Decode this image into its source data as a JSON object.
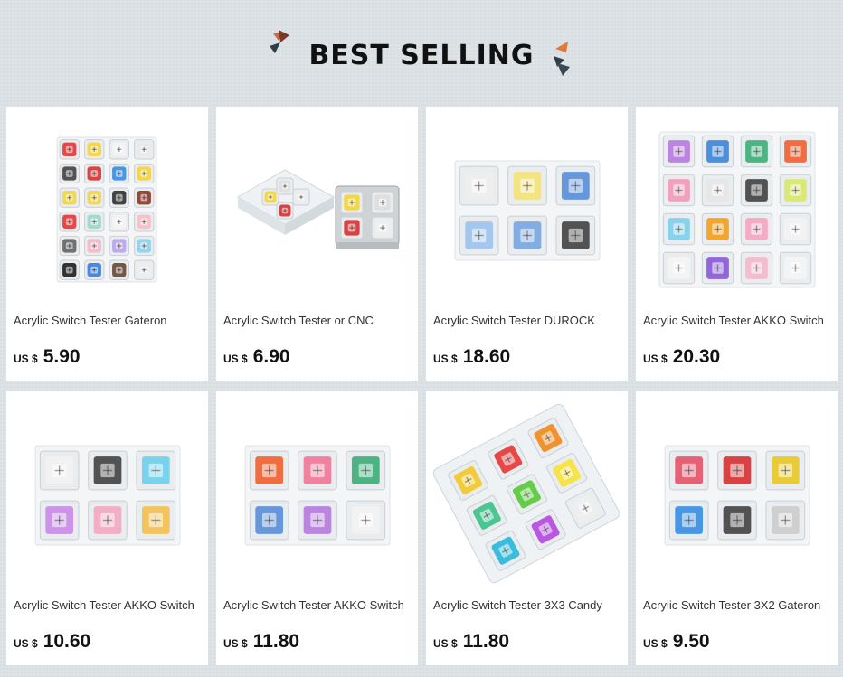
{
  "header": {
    "title": "BEST SELLING"
  },
  "currency_label": "US $",
  "products": [
    {
      "title": "Acrylic Switch Tester Gateron",
      "price": "5.90",
      "image": "acrylic-tester-24-switches",
      "grid": [
        4,
        6
      ],
      "colors": [
        "#e53a3a",
        "#f3d43b",
        "#f3f3f3",
        "#e9e9e9",
        "#444444",
        "#d73333",
        "#3a8fe3",
        "#f3d43b",
        "#f1d646",
        "#f1d646",
        "#333333",
        "#8b3a2a",
        "#e53a3a",
        "#9bd9c8",
        "#f3f3f3",
        "#f5c0c8",
        "#666666",
        "#f5b8c8",
        "#b8a5e8",
        "#8fd1ea",
        "#222222",
        "#3a7fe0",
        "#6a4a3a",
        "#eeeeee"
      ]
    },
    {
      "title": "Acrylic Switch Tester or CNC",
      "price": "6.90",
      "image": "acrylic-and-cnc-testers",
      "grid": [
        0,
        0
      ],
      "colors": []
    },
    {
      "title": "Acrylic Switch Tester DUROCK",
      "price": "18.60",
      "image": "durock-tester-6-switches",
      "grid": [
        3,
        2
      ],
      "colors": [
        "#eeeeee",
        "#f3e27a",
        "#5a8fd8",
        "#9ec3ee",
        "#7aa6df",
        "#444444"
      ]
    },
    {
      "title": "Acrylic Switch Tester AKKO Switch",
      "price": "20.30",
      "image": "akko-tester-16-switches",
      "grid": [
        4,
        4
      ],
      "colors": [
        "#b77be0",
        "#3e87d8",
        "#3fb07a",
        "#f06230",
        "#f29ab8",
        "#e6e6e6",
        "#444444",
        "#d8e86a",
        "#7fd0ea",
        "#f2a020",
        "#f4a5c0",
        "#f2f2f2",
        "#f4f4f4",
        "#8a5ad8",
        "#f2b9cc",
        "#f4f4f4"
      ]
    },
    {
      "title": "Acrylic Switch Tester AKKO Switch",
      "price": "10.60",
      "image": "akko-tester-6-switches",
      "grid": [
        3,
        2
      ],
      "colors": [
        "#f2f2f2",
        "#444444",
        "#6fd0ea",
        "#c98be8",
        "#f2a8c0",
        "#f2c050"
      ]
    },
    {
      "title": "Acrylic Switch Tester AKKO Switch",
      "price": "11.80",
      "image": "akko-tester-6-switches-b",
      "grid": [
        3,
        2
      ],
      "colors": [
        "#f06230",
        "#f07898",
        "#3fae7a",
        "#5a8fd8",
        "#b77be0",
        "#f2f2f2"
      ]
    },
    {
      "title": "Acrylic Switch Tester 3X3 Candy",
      "price": "11.80",
      "image": "candy-tester-3x3",
      "grid": [
        3,
        3
      ],
      "colors": [
        "#f2c82a",
        "#e53a3a",
        "#f08a20",
        "#3fc18a",
        "#5ac83a",
        "#f5e23a",
        "#2ab8d8",
        "#b44ae0",
        "#eeeeee"
      ]
    },
    {
      "title": "Acrylic Switch Tester 3X2 Gateron",
      "price": "9.50",
      "image": "gateron-tester-3x2",
      "grid": [
        3,
        2
      ],
      "colors": [
        "#e5556a",
        "#d73333",
        "#e8c82a",
        "#3a8fe3",
        "#444444",
        "#cccccc"
      ]
    }
  ]
}
